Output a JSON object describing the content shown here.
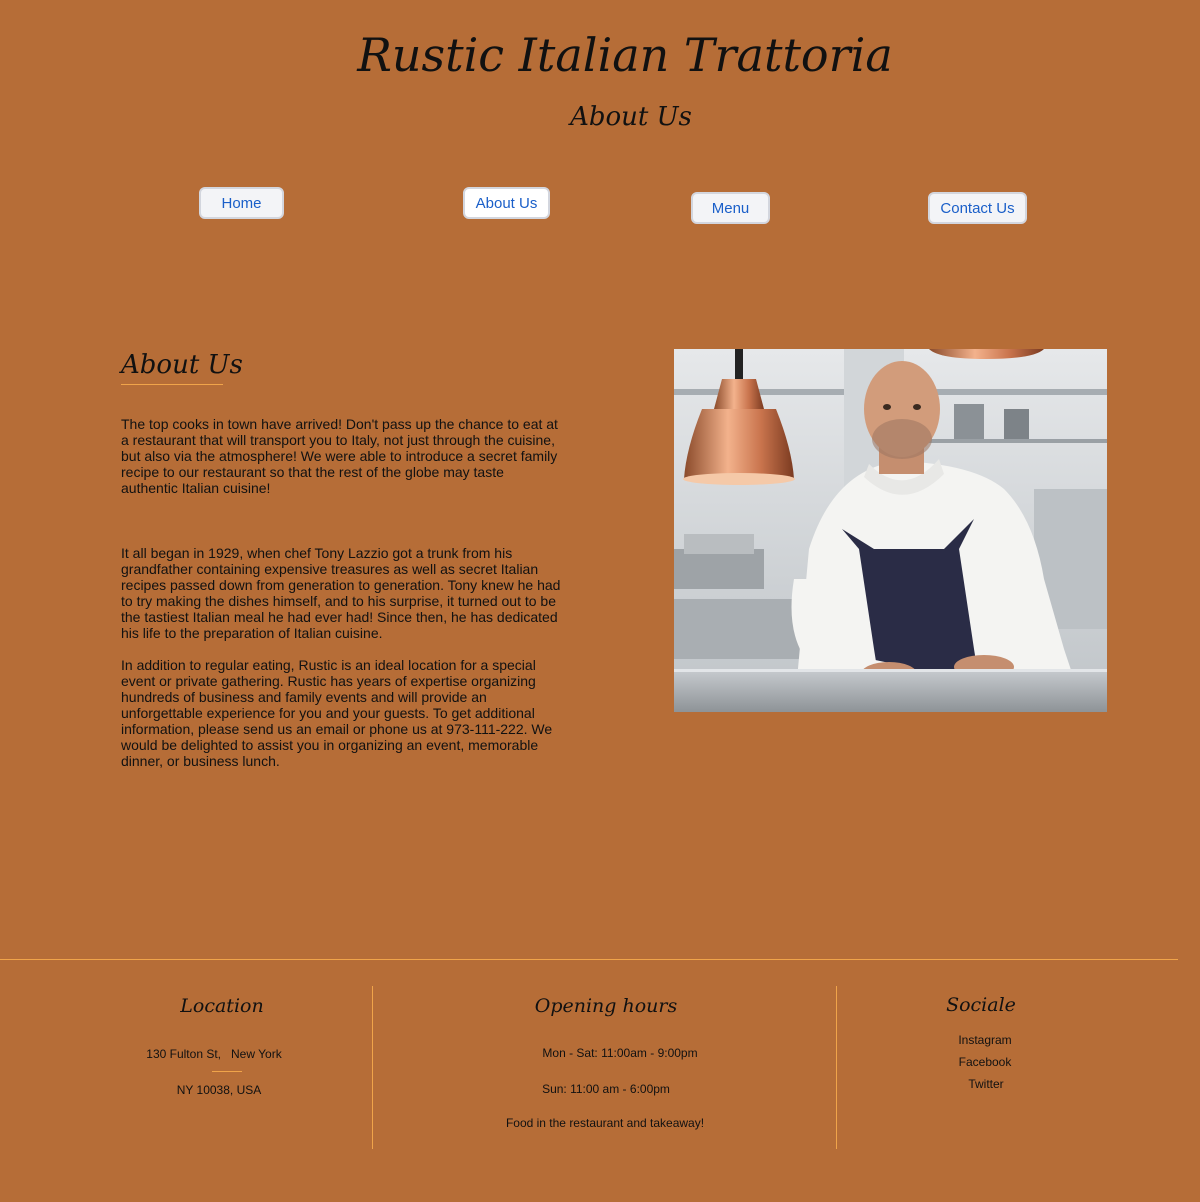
{
  "header": {
    "site_title": "Rustic Italian Trattoria",
    "page_subtitle": "About Us"
  },
  "nav": {
    "home": "Home",
    "about": "About Us",
    "menu": "Menu",
    "contact": "Contact Us"
  },
  "about": {
    "heading": "About Us",
    "paragraphs": [
      "The top cooks in town have arrived! Don't pass up the chance to eat at a restaurant that will transport you to Italy, not just through the cuisine, but also via the atmosphere! We were able to introduce a secret family recipe to our restaurant so that the rest of the globe may taste authentic Italian cuisine!",
      "It all began in 1929, when chef Tony Lazzio got a trunk from his grandfather containing expensive treasures as well as secret Italian recipes passed down from generation to generation. Tony knew he had to try making the dishes himself, and to his surprise, it turned out to be the tastiest Italian meal he had ever had! Since then, he has dedicated his life to the preparation of Italian cuisine.",
      "In addition to regular eating, Rustic is an ideal location for a special event or private gathering. Rustic has years of expertise organizing hundreds of business and family events and will provide an unforgettable experience for you and your guests. To get additional information, please send us an email or phone us at 973-111-222. We would be delighted to assist you in organizing an event, memorable dinner, or business lunch."
    ]
  },
  "footer": {
    "location": {
      "heading": "Location",
      "street": "130 Fulton St,   New York",
      "city": "NY 10038, USA"
    },
    "hours": {
      "heading": "Opening hours",
      "weekdays": "Mon - Sat: 11:00am - 9:00pm",
      "sunday": "Sun: 11:00 am - 6:00pm",
      "note": "Food in the restaurant and takeaway!"
    },
    "social": {
      "heading": "Sociale",
      "links": [
        "Instagram",
        "Facebook",
        "Twitter"
      ]
    }
  },
  "colors": {
    "background": "#b66d37",
    "accent_line": "#f0a44a",
    "button_text": "#1a5fc9"
  },
  "icons": {
    "chef_photo": "chef-photo"
  }
}
